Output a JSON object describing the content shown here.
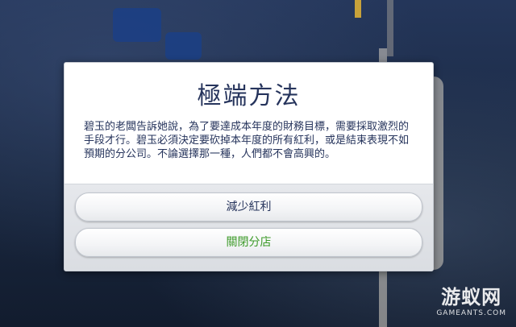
{
  "dialog": {
    "title": "極端方法",
    "body": "碧玉的老闆告訴她說，為了要達成本年度的財務目標，需要採取激烈的手段才行。碧玉必須決定要砍掉本年度的所有紅利，或是結束表現不如預期的分公司。不論選擇那一種，人們都不會高興的。",
    "choices": [
      {
        "label": "減少紅利"
      },
      {
        "label": "關閉分店"
      }
    ]
  },
  "watermark": {
    "logo": "游蚁网",
    "subtitle": "GAMEANTS.COM"
  },
  "colors": {
    "title": "#26345c",
    "choice_primary": "#26345c",
    "choice_secondary": "#3c9a28"
  }
}
